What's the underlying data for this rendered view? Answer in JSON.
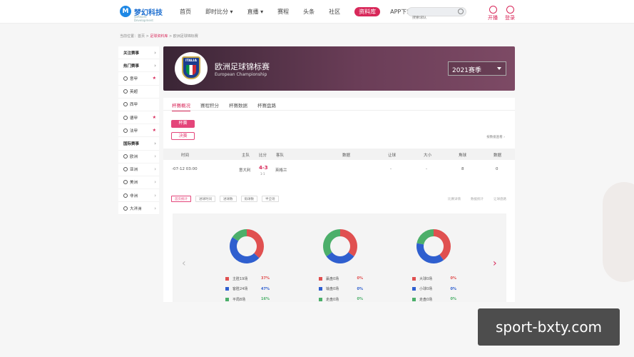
{
  "topnav": {
    "logo_text": "梦幻科技",
    "logo_sub": "Software Development",
    "links": [
      "首页",
      "即时比分 ▾",
      "直播 ▾",
      "赛程",
      "头条",
      "社区",
      "资料库",
      "APP下载"
    ],
    "active_index": 6,
    "search_placeholder": "搜索球队",
    "open_label": "开播",
    "login_label": "登录"
  },
  "breadcrumb": {
    "prefix": "当前位置：",
    "home": "首页",
    "sep": " > ",
    "section": "足球资料库",
    "current": "欧洲足球锦标赛"
  },
  "sidebar": {
    "items": [
      {
        "label": "关注赛事",
        "type": "head",
        "marker": "chevron"
      },
      {
        "label": "热门赛事",
        "type": "head",
        "marker": "chevron"
      },
      {
        "label": "意甲",
        "type": "item",
        "marker": "star"
      },
      {
        "label": "英超",
        "type": "item",
        "marker": "none"
      },
      {
        "label": "西甲",
        "type": "item",
        "marker": "none"
      },
      {
        "label": "德甲",
        "type": "item",
        "marker": "star"
      },
      {
        "label": "法甲",
        "type": "item",
        "marker": "star"
      },
      {
        "label": "国际赛事",
        "type": "head",
        "marker": "chevron"
      },
      {
        "label": "欧洲",
        "type": "item",
        "marker": "chevron"
      },
      {
        "label": "亚洲",
        "type": "item",
        "marker": "chevron"
      },
      {
        "label": "美洲",
        "type": "item",
        "marker": "chevron"
      },
      {
        "label": "非洲",
        "type": "item",
        "marker": "chevron"
      },
      {
        "label": "大洋洲",
        "type": "item",
        "marker": "chevron"
      }
    ]
  },
  "hero": {
    "title": "欧洲足球锦标赛",
    "subtitle": "European Championship",
    "badge_text": "ITALIA",
    "season": "2021赛季"
  },
  "tabs": [
    {
      "label": "杯赛概况",
      "active": true
    },
    {
      "label": "赛程积分",
      "active": false
    },
    {
      "label": "杯赛数据",
      "active": false
    },
    {
      "label": "杯赛盘路",
      "active": false
    }
  ],
  "stage_pills": {
    "primary": "杯赛",
    "secondary": "决赛"
  },
  "link_right": "按数据查看 ›",
  "table": {
    "headers": [
      "时间",
      "主队",
      "比分",
      "客队",
      "数据",
      "让球",
      "大小",
      "角球",
      "数据"
    ],
    "rows": [
      {
        "time": "-07-12 03:00",
        "home": "意大利",
        "score": "4-3",
        "ht": "1-1",
        "away": "英格兰",
        "data": "",
        "handicap": "-",
        "overunder": "-",
        "corner": "8",
        "data2": "0"
      }
    ]
  },
  "filter_buttons": [
    "首页统计",
    "进球时间",
    "进球数",
    "角球数",
    "半全场"
  ],
  "right_links": [
    "比赛详情",
    "数据统计",
    "让球盘路"
  ],
  "stats": [
    {
      "legend": [
        {
          "label": "主胜19场",
          "pct": "37%",
          "color": "#e05050"
        },
        {
          "label": "客胜24场",
          "pct": "47%",
          "color": "#2f5fcf"
        },
        {
          "label": "平局8场",
          "pct": "16%",
          "color": "#4caf6a"
        }
      ],
      "slices": [
        37,
        47,
        16
      ]
    },
    {
      "legend": [
        {
          "label": "赢盘0场",
          "pct": "0%",
          "color": "#e05050"
        },
        {
          "label": "输盘0场",
          "pct": "0%",
          "color": "#2f5fcf"
        },
        {
          "label": "走盘0场",
          "pct": "0%",
          "color": "#4caf6a"
        }
      ],
      "slices": [
        35,
        30,
        35
      ]
    },
    {
      "legend": [
        {
          "label": "大球0场",
          "pct": "0%",
          "color": "#e05050"
        },
        {
          "label": "小球0场",
          "pct": "0%",
          "color": "#2f5fcf"
        },
        {
          "label": "走盘0场",
          "pct": "0%",
          "color": "#4caf6a"
        }
      ],
      "slices": [
        40,
        38,
        22
      ]
    }
  ],
  "watermark": "sport-bxty.com"
}
